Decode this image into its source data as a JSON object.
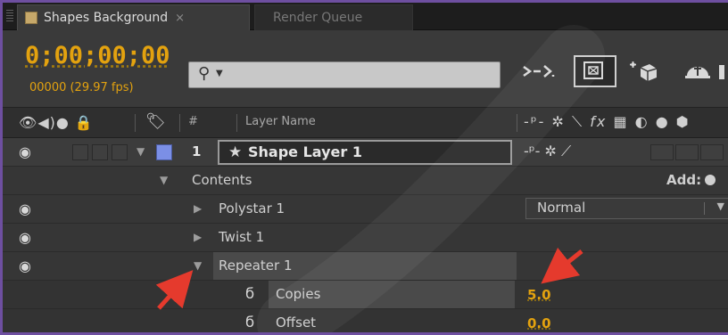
{
  "tabs": {
    "active_label": "Shapes Background",
    "close_glyph": "×",
    "inactive_label": "Render Queue"
  },
  "controls": {
    "timecode": "0;00;00;00",
    "frame_info": "00000 (29.97 fps)",
    "search_value": ""
  },
  "header": {
    "hash": "#",
    "layer_name": "Layer Name"
  },
  "layer": {
    "number": "1",
    "name": "Shape Layer 1",
    "label_color": "#7b8fe6"
  },
  "contents": {
    "label": "Contents",
    "add_label": "Add:"
  },
  "items": {
    "polystar": "Polystar 1",
    "twist": "Twist 1",
    "repeater": "Repeater 1",
    "blend_mode": "Normal"
  },
  "properties": {
    "copies_label": "Copies",
    "copies_value": "5.0",
    "offset_label": "Offset",
    "offset_value": "0.0"
  },
  "colors": {
    "accent_timecode": "#e3a20f",
    "panel_border": "#6e4fa0",
    "annotation_arrow": "#e53a2d"
  }
}
